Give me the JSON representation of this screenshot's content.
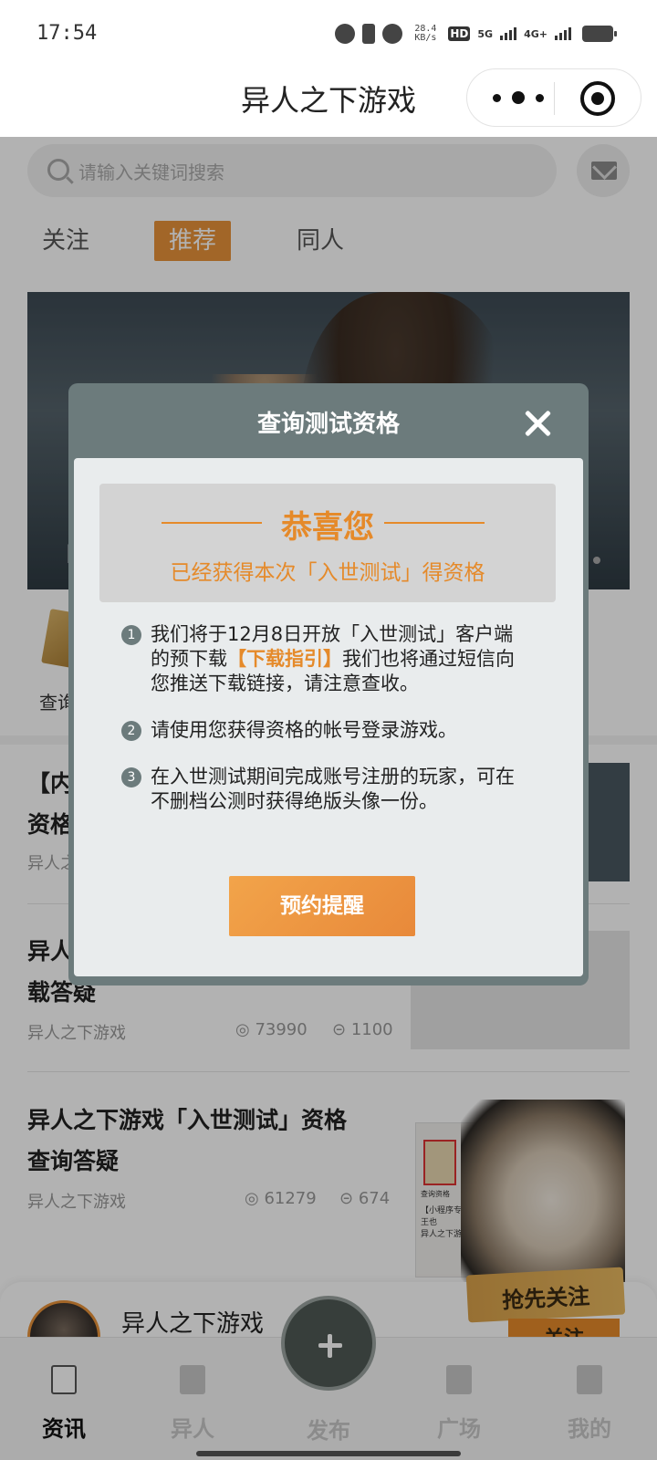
{
  "status_bar": {
    "time": "17:54",
    "speed_value": "28.4",
    "speed_unit": "KB/s",
    "hd_label": "HD",
    "net_5g": "5G",
    "net_4g": "4G+"
  },
  "title_bar": {
    "title": "异人之下游戏"
  },
  "search": {
    "placeholder": "请输入关键词搜索"
  },
  "tabs": [
    {
      "label": "关注",
      "active": false
    },
    {
      "label": "推荐",
      "active": true
    },
    {
      "label": "同人",
      "active": false
    }
  ],
  "banner": {
    "caption": "【"
  },
  "quick_action": {
    "label": "查询"
  },
  "articles": [
    {
      "title_line1": "【内",
      "title_line2": "资格",
      "author": "异人之"
    },
    {
      "title_line1": "异人",
      "title_line2": "载答疑",
      "author": "异人之下游戏",
      "views": "73990",
      "comments": "1100"
    },
    {
      "title_line1": "异人之下游戏「入世测试」资格",
      "title_line2": "查询答疑",
      "author": "异人之下游戏",
      "views": "61279",
      "comments": "674"
    }
  ],
  "thumb3": {
    "doc_caption": "查询资格",
    "desc_line1": "【小程序专属】",
    "desc_line2": "王也",
    "desc_line3": "异人之下游戏"
  },
  "promo": {
    "ribbon": "抢先关注",
    "follow": "关注"
  },
  "profile": {
    "name": "异人之下游戏"
  },
  "tabbar": [
    {
      "label": "资讯",
      "icon": "news-icon",
      "active": true
    },
    {
      "label": "异人",
      "icon": "scroll-icon",
      "active": false
    },
    {
      "label": "发布",
      "icon": "plus-icon",
      "active": false
    },
    {
      "label": "广场",
      "icon": "chat-icon",
      "active": false
    },
    {
      "label": "我的",
      "icon": "user-icon",
      "active": false
    }
  ],
  "modal": {
    "title": "查询测试资格",
    "congrats_title": "恭喜您",
    "congrats_sub": "已经获得本次「入世测试」得资格",
    "item1_prefix": "我们将于12月8日开放「入世测试」客户端的预下载",
    "item1_link": "【下载指引】",
    "item1_suffix": "我们也将通过短信向您推送下载链接，请注意查收。",
    "item2": "请使用您获得资格的帐号登录游戏。",
    "item3": "在入世测试期间完成账号注册的玩家，可在不删档公测时获得绝版头像一份。",
    "button": "预约提醒",
    "accent_color": "#e58a2a",
    "header_color": "#6c7b7c"
  }
}
